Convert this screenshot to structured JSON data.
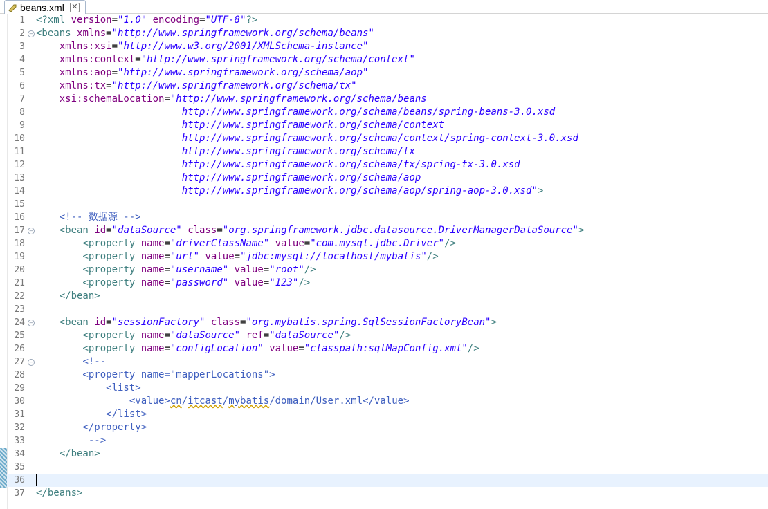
{
  "tab": {
    "title": "beans.xml",
    "icon": "xml-file-icon",
    "close": "✕"
  },
  "lines": [
    {
      "n": "1",
      "tokens": [
        [
          "tag",
          "<?xml "
        ],
        [
          "attr",
          "version"
        ],
        [
          "txt",
          "="
        ],
        [
          "val",
          "\"1.0\""
        ],
        [
          "txt",
          " "
        ],
        [
          "attr",
          "encoding"
        ],
        [
          "txt",
          "="
        ],
        [
          "val",
          "\"UTF-8\""
        ],
        [
          "tag",
          "?>"
        ]
      ]
    },
    {
      "n": "2",
      "fold": true,
      "tokens": [
        [
          "tag",
          "<beans "
        ],
        [
          "attr",
          "xmlns"
        ],
        [
          "txt",
          "="
        ],
        [
          "val",
          "\"http://www.springframework.org/schema/beans\""
        ]
      ]
    },
    {
      "n": "3",
      "tokens": [
        [
          "txt",
          "    "
        ],
        [
          "attr",
          "xmlns:xsi"
        ],
        [
          "txt",
          "="
        ],
        [
          "val",
          "\"http://www.w3.org/2001/XMLSchema-instance\""
        ]
      ]
    },
    {
      "n": "4",
      "tokens": [
        [
          "txt",
          "    "
        ],
        [
          "attr",
          "xmlns:context"
        ],
        [
          "txt",
          "="
        ],
        [
          "val",
          "\"http://www.springframework.org/schema/context\""
        ]
      ]
    },
    {
      "n": "5",
      "tokens": [
        [
          "txt",
          "    "
        ],
        [
          "attr",
          "xmlns:aop"
        ],
        [
          "txt",
          "="
        ],
        [
          "val",
          "\"http://www.springframework.org/schema/aop\""
        ]
      ]
    },
    {
      "n": "6",
      "tokens": [
        [
          "txt",
          "    "
        ],
        [
          "attr",
          "xmlns:tx"
        ],
        [
          "txt",
          "="
        ],
        [
          "val",
          "\"http://www.springframework.org/schema/tx\""
        ]
      ]
    },
    {
      "n": "7",
      "tokens": [
        [
          "txt",
          "    "
        ],
        [
          "attr",
          "xsi:schemaLocation"
        ],
        [
          "txt",
          "="
        ],
        [
          "val",
          "\"http://www.springframework.org/schema/beans"
        ]
      ]
    },
    {
      "n": "8",
      "tokens": [
        [
          "txt",
          "                         "
        ],
        [
          "val",
          "http://www.springframework.org/schema/beans/spring-beans-3.0.xsd"
        ]
      ]
    },
    {
      "n": "9",
      "tokens": [
        [
          "txt",
          "                         "
        ],
        [
          "val",
          "http://www.springframework.org/schema/context"
        ]
      ]
    },
    {
      "n": "10",
      "tokens": [
        [
          "txt",
          "                         "
        ],
        [
          "val",
          "http://www.springframework.org/schema/context/spring-context-3.0.xsd"
        ]
      ]
    },
    {
      "n": "11",
      "tokens": [
        [
          "txt",
          "                         "
        ],
        [
          "val",
          "http://www.springframework.org/schema/tx"
        ]
      ]
    },
    {
      "n": "12",
      "tokens": [
        [
          "txt",
          "                         "
        ],
        [
          "val",
          "http://www.springframework.org/schema/tx/spring-tx-3.0.xsd"
        ]
      ]
    },
    {
      "n": "13",
      "tokens": [
        [
          "txt",
          "                         "
        ],
        [
          "val",
          "http://www.springframework.org/schema/aop"
        ]
      ]
    },
    {
      "n": "14",
      "tokens": [
        [
          "txt",
          "                         "
        ],
        [
          "val",
          "http://www.springframework.org/schema/aop/spring-aop-3.0.xsd\""
        ],
        [
          "tag",
          ">"
        ]
      ]
    },
    {
      "n": "15",
      "tokens": []
    },
    {
      "n": "16",
      "tokens": [
        [
          "txt",
          "    "
        ],
        [
          "com",
          "<!-- 数据源 -->"
        ]
      ]
    },
    {
      "n": "17",
      "fold": true,
      "tokens": [
        [
          "txt",
          "    "
        ],
        [
          "tag",
          "<bean "
        ],
        [
          "attr",
          "id"
        ],
        [
          "txt",
          "="
        ],
        [
          "val",
          "\"dataSource\""
        ],
        [
          "txt",
          " "
        ],
        [
          "attr",
          "class"
        ],
        [
          "txt",
          "="
        ],
        [
          "val",
          "\"org.springframework.jdbc.datasource.DriverManagerDataSource\""
        ],
        [
          "tag",
          ">"
        ]
      ]
    },
    {
      "n": "18",
      "tokens": [
        [
          "txt",
          "        "
        ],
        [
          "tag",
          "<property "
        ],
        [
          "attr",
          "name"
        ],
        [
          "txt",
          "="
        ],
        [
          "val",
          "\"driverClassName\""
        ],
        [
          "txt",
          " "
        ],
        [
          "attr",
          "value"
        ],
        [
          "txt",
          "="
        ],
        [
          "val",
          "\"com.mysql.jdbc.Driver\""
        ],
        [
          "tag",
          "/>"
        ]
      ]
    },
    {
      "n": "19",
      "tokens": [
        [
          "txt",
          "        "
        ],
        [
          "tag",
          "<property "
        ],
        [
          "attr",
          "name"
        ],
        [
          "txt",
          "="
        ],
        [
          "val",
          "\"url\""
        ],
        [
          "txt",
          " "
        ],
        [
          "attr",
          "value"
        ],
        [
          "txt",
          "="
        ],
        [
          "val",
          "\"jdbc:mysql://localhost/mybatis\""
        ],
        [
          "tag",
          "/>"
        ]
      ]
    },
    {
      "n": "20",
      "tokens": [
        [
          "txt",
          "        "
        ],
        [
          "tag",
          "<property "
        ],
        [
          "attr",
          "name"
        ],
        [
          "txt",
          "="
        ],
        [
          "val",
          "\"username\""
        ],
        [
          "txt",
          " "
        ],
        [
          "attr",
          "value"
        ],
        [
          "txt",
          "="
        ],
        [
          "val",
          "\"root\""
        ],
        [
          "tag",
          "/>"
        ]
      ]
    },
    {
      "n": "21",
      "tokens": [
        [
          "txt",
          "        "
        ],
        [
          "tag",
          "<property "
        ],
        [
          "attr",
          "name"
        ],
        [
          "txt",
          "="
        ],
        [
          "val",
          "\"password\""
        ],
        [
          "txt",
          " "
        ],
        [
          "attr",
          "value"
        ],
        [
          "txt",
          "="
        ],
        [
          "val",
          "\"123\""
        ],
        [
          "tag",
          "/>"
        ]
      ]
    },
    {
      "n": "22",
      "tokens": [
        [
          "txt",
          "    "
        ],
        [
          "tag",
          "</bean>"
        ]
      ]
    },
    {
      "n": "23",
      "tokens": []
    },
    {
      "n": "24",
      "fold": true,
      "tokens": [
        [
          "txt",
          "    "
        ],
        [
          "tag",
          "<bean "
        ],
        [
          "attr",
          "id"
        ],
        [
          "txt",
          "="
        ],
        [
          "val",
          "\"sessionFactory\""
        ],
        [
          "txt",
          " "
        ],
        [
          "attr",
          "class"
        ],
        [
          "txt",
          "="
        ],
        [
          "val",
          "\"org.mybatis.spring.SqlSessionFactoryBean\""
        ],
        [
          "tag",
          ">"
        ]
      ]
    },
    {
      "n": "25",
      "tokens": [
        [
          "txt",
          "        "
        ],
        [
          "tag",
          "<property "
        ],
        [
          "attr",
          "name"
        ],
        [
          "txt",
          "="
        ],
        [
          "val",
          "\"dataSource\""
        ],
        [
          "txt",
          " "
        ],
        [
          "attr",
          "ref"
        ],
        [
          "txt",
          "="
        ],
        [
          "val",
          "\"dataSource\""
        ],
        [
          "tag",
          "/>"
        ]
      ]
    },
    {
      "n": "26",
      "tokens": [
        [
          "txt",
          "        "
        ],
        [
          "tag",
          "<property "
        ],
        [
          "attr",
          "name"
        ],
        [
          "txt",
          "="
        ],
        [
          "val",
          "\"configLocation\""
        ],
        [
          "txt",
          " "
        ],
        [
          "attr",
          "value"
        ],
        [
          "txt",
          "="
        ],
        [
          "val",
          "\"classpath:sqlMapConfig.xml\""
        ],
        [
          "tag",
          "/>"
        ]
      ]
    },
    {
      "n": "27",
      "fold": true,
      "tokens": [
        [
          "txt",
          "        "
        ],
        [
          "com",
          "<!--"
        ]
      ]
    },
    {
      "n": "28",
      "tokens": [
        [
          "com",
          "        <property name=\"mapperLocations\">"
        ]
      ]
    },
    {
      "n": "29",
      "tokens": [
        [
          "com",
          "            <list>"
        ]
      ]
    },
    {
      "n": "30",
      "tokens": [
        [
          "com",
          "                <value>"
        ],
        [
          "comerr",
          "cn"
        ],
        [
          "com",
          "/"
        ],
        [
          "comerr",
          "itcast"
        ],
        [
          "com",
          "/"
        ],
        [
          "comerr",
          "mybatis"
        ],
        [
          "com",
          "/domain/User.xml</value>"
        ]
      ]
    },
    {
      "n": "31",
      "tokens": [
        [
          "com",
          "            </list>"
        ]
      ]
    },
    {
      "n": "32",
      "tokens": [
        [
          "com",
          "        </property>"
        ]
      ]
    },
    {
      "n": "33",
      "tokens": [
        [
          "com",
          "         -->"
        ]
      ]
    },
    {
      "n": "34",
      "tokens": [
        [
          "txt",
          "    "
        ],
        [
          "tag",
          "</bean>"
        ]
      ]
    },
    {
      "n": "35",
      "tokens": []
    },
    {
      "n": "36",
      "current": true,
      "tokens": []
    },
    {
      "n": "37",
      "tokens": [
        [
          "tag",
          "</beans>"
        ]
      ]
    }
  ]
}
